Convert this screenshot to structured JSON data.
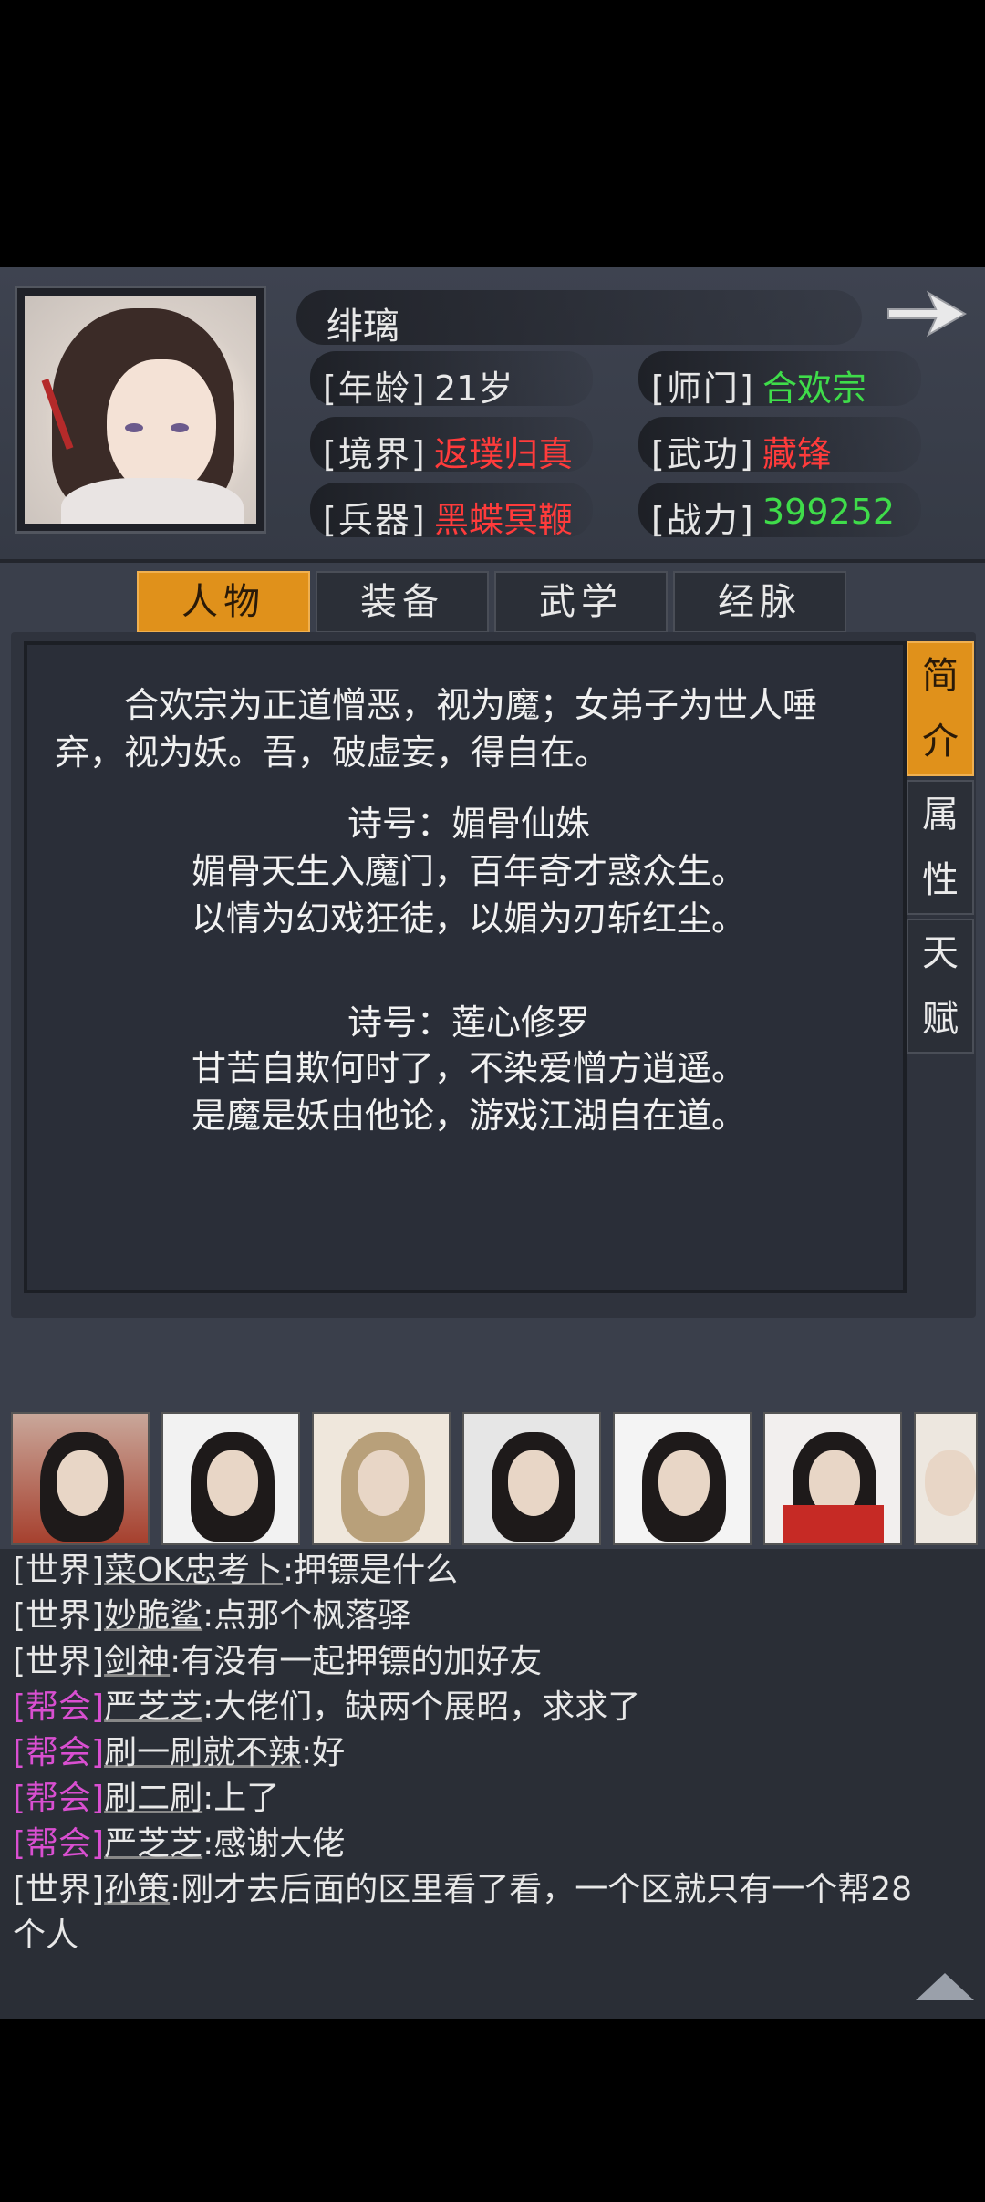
{
  "profile": {
    "name": "绯璃",
    "attributes": [
      {
        "label": "[年龄]",
        "value": "21岁",
        "color": "#e8e8e8"
      },
      {
        "label": "[师门]",
        "value": "合欢宗",
        "color": "#3fdc4a"
      },
      {
        "label": "[境界]",
        "value": "返璞归真",
        "color": "#ff3b3b"
      },
      {
        "label": "[武功]",
        "value": "藏锋",
        "color": "#ff3b3b"
      },
      {
        "label": "[兵器]",
        "value": "黑蝶冥鞭",
        "color": "#ff3b3b"
      },
      {
        "label": "[战力]",
        "value": "399252",
        "color": "#3fdc4a"
      }
    ]
  },
  "tabs": [
    {
      "label": "人物",
      "active": true
    },
    {
      "label": "装备",
      "active": false
    },
    {
      "label": "武学",
      "active": false
    },
    {
      "label": "经脉",
      "active": false
    }
  ],
  "side_tabs": [
    {
      "label_top": "简",
      "label_bottom": "介",
      "active": true
    },
    {
      "label_top": "属",
      "label_bottom": "性",
      "active": false
    },
    {
      "label_top": "天",
      "label_bottom": "赋",
      "active": false
    }
  ],
  "intro": {
    "text": "合欢宗为正道憎恶，视为魔；女弟子为世人唾弃，视为妖。吾，破虚妄，得自在。",
    "poems": [
      {
        "title": "诗号：媚骨仙姝",
        "line1": "媚骨天生入魔门，百年奇才惑众生。",
        "line2": "以情为幻戏狂徒，以媚为刃斩红尘。"
      },
      {
        "title": "诗号：莲心修罗",
        "line1": "甘苦自欺何时了，不染爱憎方逍遥。",
        "line2": "是魔是妖由他论，游戏江湖自在道。"
      }
    ]
  },
  "chat": [
    {
      "channel": "[世界]",
      "nick": "菜OK忠考卜",
      "msg": ":押镖是什么",
      "type": "world"
    },
    {
      "channel": "[世界]",
      "nick": "妙脆鲨",
      "msg": ":点那个枫落驿",
      "type": "world"
    },
    {
      "channel": "[世界]",
      "nick": "剑神",
      "msg": ":有没有一起押镖的加好友",
      "type": "world"
    },
    {
      "channel": "[帮会]",
      "nick": "严芝芝",
      "msg": ":大佬们，缺两个展昭，求求了",
      "type": "guild"
    },
    {
      "channel": "[帮会]",
      "nick": "刷一刷就不辣",
      "msg": ":好",
      "type": "guild"
    },
    {
      "channel": "[帮会]",
      "nick": "刷二刷",
      "msg": ":上了",
      "type": "guild"
    },
    {
      "channel": "[帮会]",
      "nick": "严芝芝",
      "msg": ":感谢大佬",
      "type": "guild"
    },
    {
      "channel": "[世界]",
      "nick": "孙策",
      "msg": ":刚才去后面的区里看了看，一个区就只有一个帮28",
      "type": "world"
    },
    {
      "channel": "",
      "nick": "",
      "msg": "个人",
      "type": "world"
    }
  ],
  "colors": {
    "accent": "#e0911b",
    "guild": "#d94fd1",
    "green": "#3fdc4a",
    "red": "#ff3b3b"
  },
  "icons": {
    "next": "arrow-right-icon",
    "scroll": "scroll-up-icon"
  }
}
